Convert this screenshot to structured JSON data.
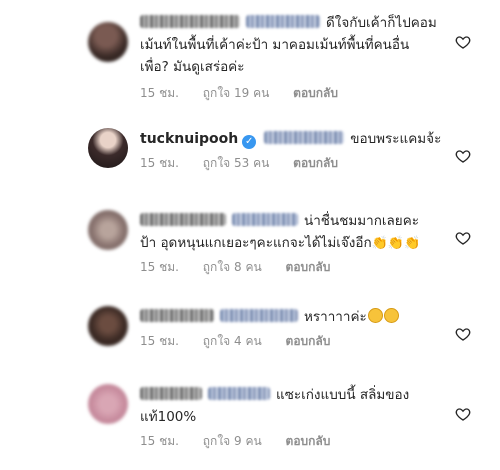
{
  "comments": [
    {
      "username_hidden": true,
      "text_line1": "ดีใจกับเค้าก็ไปคอม",
      "text_line2": "เม้นท์ในพื้นที่เค้าค่ะป้า มาคอมเม้นท์พื้นที่คนอื่น",
      "text_line3": "เพื่อ? มันดูเสร่อค่ะ",
      "time": "15 ชม.",
      "likes": "ถูกใจ 19 คน",
      "reply": "ตอบกลับ"
    },
    {
      "username": "tucknuipooh",
      "verified": true,
      "text_line1": "ขอบพระแคมจ้ะ",
      "time": "15 ชม.",
      "likes": "ถูกใจ 53 คน",
      "reply": "ตอบกลับ"
    },
    {
      "username_hidden": true,
      "text_line1": "น่าชื่นชมมากเลยคะ",
      "text_line2": "ป้า อุดหนุนแกเยอะๆคะแกจะได้ไม่เจ๊งอีก",
      "emoji": "👏👏👏",
      "time": "15 ชม.",
      "likes": "ถูกใจ 8 คน",
      "reply": "ตอบกลับ"
    },
    {
      "username_hidden": true,
      "text_line1": "หราาาาค่ะ",
      "emoji": "☺☺",
      "time": "15 ชม.",
      "likes": "ถูกใจ 4 คน",
      "reply": "ตอบกลับ"
    },
    {
      "username_hidden": true,
      "text_line1": "แซะเก่งแบบนี้ สลิ่มของ",
      "text_line2": "แท้100%",
      "time": "15 ชม.",
      "likes": "ถูกใจ 9 คน",
      "reply": "ตอบกลับ"
    }
  ]
}
